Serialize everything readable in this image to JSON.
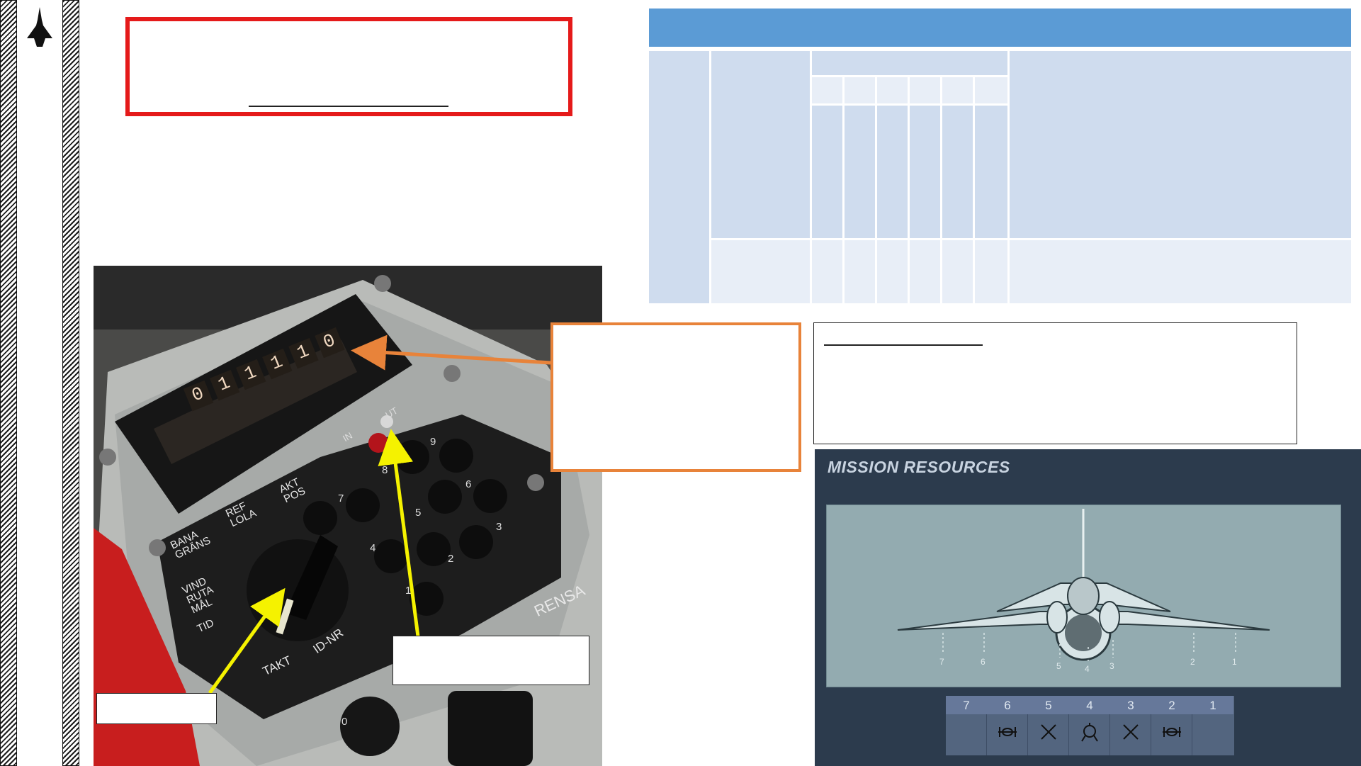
{
  "mission_resources": {
    "title": "MISSION RESOURCES",
    "pylons": [
      {
        "number": "7",
        "store": ""
      },
      {
        "number": "6",
        "store": "pod-icon"
      },
      {
        "number": "5",
        "store": "cross-icon"
      },
      {
        "number": "4",
        "store": "tank-icon"
      },
      {
        "number": "3",
        "store": "cross-icon"
      },
      {
        "number": "2",
        "store": "pod-icon"
      },
      {
        "number": "1",
        "store": ""
      }
    ],
    "aircraft_pylon_labels": [
      "7",
      "6",
      "5",
      "4",
      "3",
      "2",
      "1"
    ]
  },
  "cockpit_panel": {
    "display_digits": [
      "0",
      "1",
      "1",
      "1",
      "1",
      "0"
    ],
    "switch_labels": {
      "in": "IN",
      "ut": "UT"
    },
    "knob_labels": [
      "BANA GRÄNS",
      "REF LOLA",
      "AKT POS",
      "VIND RUTA MÅL",
      "TID",
      "TAKT",
      "ID-NR"
    ],
    "keypad": [
      "9",
      "8",
      "7",
      "6",
      "5",
      "4",
      "3",
      "2",
      "1",
      "0"
    ],
    "rensa_label": "RENSA"
  },
  "colors": {
    "title_border": "#e51a1a",
    "table_header": "#5b9bd5",
    "table_dark": "#cfdcee",
    "table_light": "#e8eef7",
    "callout_orange": "#e8833a",
    "arrow_yellow": "#f5f200"
  }
}
